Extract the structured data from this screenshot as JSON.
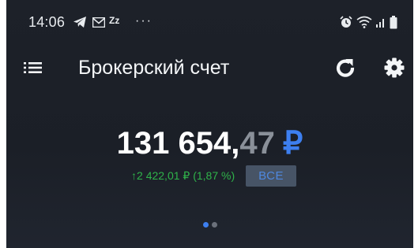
{
  "status_bar": {
    "time": "14:06",
    "z_icon": "Zz",
    "more": "···",
    "icons": [
      "telegram-icon",
      "mail-icon",
      "sleep-icon",
      "more-icon",
      "alarm-icon",
      "wifi-icon",
      "signal-icon",
      "battery-icon"
    ]
  },
  "header": {
    "title": "Брокерский счет",
    "menu_icon": "list-menu-icon",
    "refresh_icon": "refresh-icon",
    "settings_icon": "gear-icon"
  },
  "balance": {
    "integer_part": "131 654,",
    "fraction_part": "47",
    "currency": "₽"
  },
  "change": {
    "arrow": "↑",
    "text": "2 422,01 ₽ (1,87 %)"
  },
  "period_button": {
    "label": "ВСЕ"
  },
  "pager": {
    "pages": 2,
    "active_index": 0
  },
  "colors": {
    "background": "#1d2129",
    "accent_blue": "#3d7ff0",
    "positive_green": "#2fb34a",
    "period_button_bg": "#475466"
  }
}
